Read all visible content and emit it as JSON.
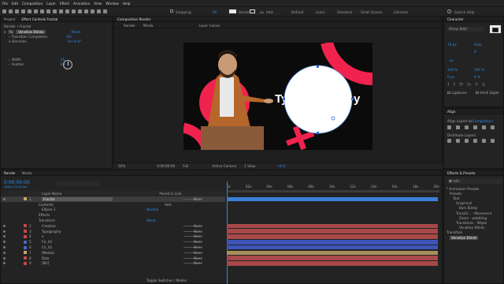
{
  "menu": [
    "File",
    "Edit",
    "Composition",
    "Layer",
    "Effect",
    "Animation",
    "View",
    "Window",
    "Help"
  ],
  "toolbar": {
    "snapping": "Snapping",
    "fill": "Fill",
    "stroke": "Stroke",
    "px": "px",
    "add": "Add:",
    "workspaces": [
      "Default",
      "Learn",
      "Standard",
      "Small Screen",
      "Libraries"
    ],
    "search_placeholder": "Search Help"
  },
  "left_panel": {
    "tabs": [
      "Project",
      "Effect Controls Fractal"
    ],
    "title": "Render • Fractal",
    "effect_name": "Venetian Blinds",
    "reset": "Reset",
    "transition_completion": "Transition Completion",
    "transition_value": "0%",
    "direction": "Direction",
    "direction_value": "0x+0.0°",
    "width": "Width",
    "width_value": "35",
    "feather": "Feather",
    "feather_value": "0.0"
  },
  "viewer": {
    "tab": "Composition Render",
    "subtabs": [
      "Render",
      "Media"
    ],
    "layer_label": "Layer (none)",
    "title_text": "Ty",
    "title_text_right": "y",
    "zoom": "50%",
    "timecode": "0:00:00:00",
    "resolution": "Full",
    "camera": "Active Camera",
    "views": "1 View",
    "exposure": "+0.0"
  },
  "character": {
    "tab": "Character",
    "font": "Gilroy Bold",
    "size": "74 px",
    "leading": "Auto",
    "tracking": "0",
    "stroke": "- px",
    "vscale": "100 %",
    "hscale": "100 %",
    "baseline": "0 px",
    "tsume": "0 %",
    "ligatures": "Ligatures",
    "hindi": "Hindi Digits"
  },
  "align": {
    "tab": "Align",
    "align_to_label": "Align Layers to:",
    "align_to_value": "Composition",
    "distribute": "Distribute Layers:"
  },
  "effects_presets": {
    "tab": "Effects & Presets",
    "search": "blin",
    "items": [
      {
        "label": "* Animation Presets",
        "indent": 0
      },
      {
        "label": "Presets",
        "indent": 1
      },
      {
        "label": "Text",
        "indent": 2
      },
      {
        "label": "Graphical",
        "indent": 3
      },
      {
        "label": "Bars Blinky",
        "indent": 4
      },
      {
        "label": "Transiti... - Movement",
        "indent": 3
      },
      {
        "label": "Zoom - wobbling",
        "indent": 4
      },
      {
        "label": "Transitions - Wipes",
        "indent": 3
      },
      {
        "label": "Venetian Blinds",
        "indent": 4
      },
      {
        "label": "Transition",
        "indent": 0
      },
      {
        "label": "Venetian Blinds",
        "indent": 1,
        "selected": true
      }
    ]
  },
  "timeline": {
    "tabs": [
      "Render",
      "Media"
    ],
    "timecode": "0:00:00:00",
    "fps": "00000 (25.00 fps)",
    "headers": {
      "layer_name": "Layer Name",
      "parent": "Parent & Link"
    },
    "time_marks": [
      "0s",
      "02s",
      "04s",
      "06s",
      "08s",
      "10s",
      "12s",
      "14s",
      "16s",
      "18s",
      "20s"
    ],
    "layers": [
      {
        "num": "1",
        "name": "Fractal",
        "color": "#c8a56a",
        "parent": "None",
        "selected": true
      },
      {
        "num": "",
        "name": "Contents",
        "color": "",
        "parent": "",
        "sub": true,
        "extra": "Add:"
      },
      {
        "num": "",
        "name": "Ellipse 1",
        "color": "",
        "parent": "Normal",
        "sub": true,
        "indent": 2
      },
      {
        "num": "",
        "name": "Effects",
        "color": "",
        "parent": "",
        "sub": true
      },
      {
        "num": "",
        "name": "Transform",
        "color": "",
        "parent": "Reset",
        "sub": true
      },
      {
        "num": "2",
        "name": "Creative",
        "color": "#c84848",
        "parent": "None",
        "bar": "#a84848"
      },
      {
        "num": "3",
        "name": "Typography",
        "color": "#c84848",
        "parent": "None",
        "bar": "#a84848"
      },
      {
        "num": "4",
        "name": "x",
        "color": "#c84848",
        "parent": "None",
        "bar": "#a84848"
      },
      {
        "num": "5",
        "name": "Cir_02",
        "color": "#4a64c8",
        "parent": "None",
        "bar": "#3d55b8"
      },
      {
        "num": "6",
        "name": "Cir_01",
        "color": "#4a64c8",
        "parent": "None",
        "bar": "#3d55b8"
      },
      {
        "num": "7",
        "name": "[Media]",
        "color": "#c8a56a",
        "parent": "None",
        "bar": "#a8905e"
      },
      {
        "num": "8",
        "name": "Dots",
        "color": "#c84848",
        "parent": "None",
        "bar": "#a84848"
      },
      {
        "num": "9",
        "name": "[BG]",
        "color": "#c84848",
        "parent": "None",
        "bar": "#a84848"
      }
    ],
    "footer": "Toggle Switches / Modes"
  },
  "colors": {
    "accent": "#2d8ceb",
    "ring": "#f0234e",
    "panel": "#232323"
  }
}
